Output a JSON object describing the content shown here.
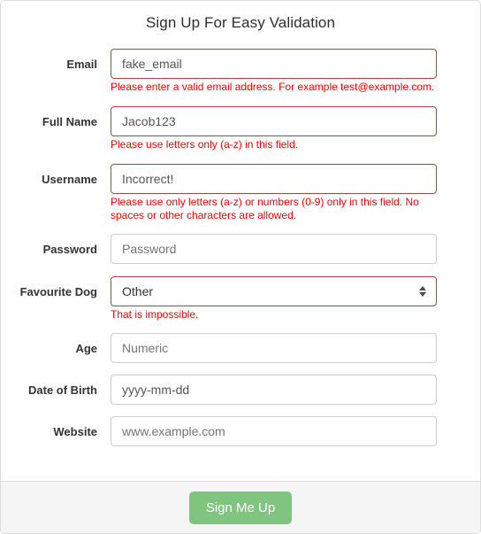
{
  "form": {
    "title": "Sign Up For Easy Validation",
    "fields": [
      {
        "key": "email",
        "label": "Email",
        "type": "text",
        "value": "fake_email",
        "placeholder": "",
        "is_value": true,
        "state": "error",
        "error": "Please enter a valid email address. For example test@example.com."
      },
      {
        "key": "fullname",
        "label": "Full Name",
        "type": "text",
        "value": "Jacob123",
        "placeholder": "",
        "is_value": true,
        "state": "error",
        "error": "Please use letters only (a-z) in this field."
      },
      {
        "key": "username",
        "label": "Username",
        "type": "text",
        "value": "Incorrect!",
        "placeholder": "",
        "is_value": true,
        "state": "error",
        "error": "Please use only letters (a-z) or numbers (0-9) only in this field. No spaces or other characters are allowed."
      },
      {
        "key": "password",
        "label": "Password",
        "type": "password",
        "value": "",
        "placeholder": "Password",
        "is_value": false,
        "state": "normal",
        "error": ""
      },
      {
        "key": "favourite_dog",
        "label": "Favourite Dog",
        "type": "select",
        "value": "Other",
        "placeholder": "",
        "is_value": true,
        "state": "error",
        "error": "That is impossible.",
        "options": [
          "Other"
        ]
      },
      {
        "key": "age",
        "label": "Age",
        "type": "text",
        "value": "",
        "placeholder": "Numeric",
        "is_value": false,
        "state": "normal",
        "error": ""
      },
      {
        "key": "dob",
        "label": "Date of Birth",
        "type": "text",
        "value": "yyyy-mm-dd",
        "placeholder": "",
        "is_value": true,
        "state": "normal",
        "error": ""
      },
      {
        "key": "website",
        "label": "Website",
        "type": "text",
        "value": "",
        "placeholder": "www.example.com",
        "is_value": false,
        "state": "normal",
        "error": ""
      }
    ],
    "submit_label": "Sign Me Up"
  },
  "icons": {
    "stepper_up": "▲",
    "stepper_down": "▼"
  },
  "colors": {
    "error_border": "#a94442",
    "error_text": "#ff0000",
    "normal_border": "#cccccc",
    "panel_border": "#dddddd",
    "footer_bg": "#f5f5f5",
    "submit_bg": "#7fc47f",
    "placeholder_text": "#a6a6a6",
    "value_text": "#555555"
  }
}
